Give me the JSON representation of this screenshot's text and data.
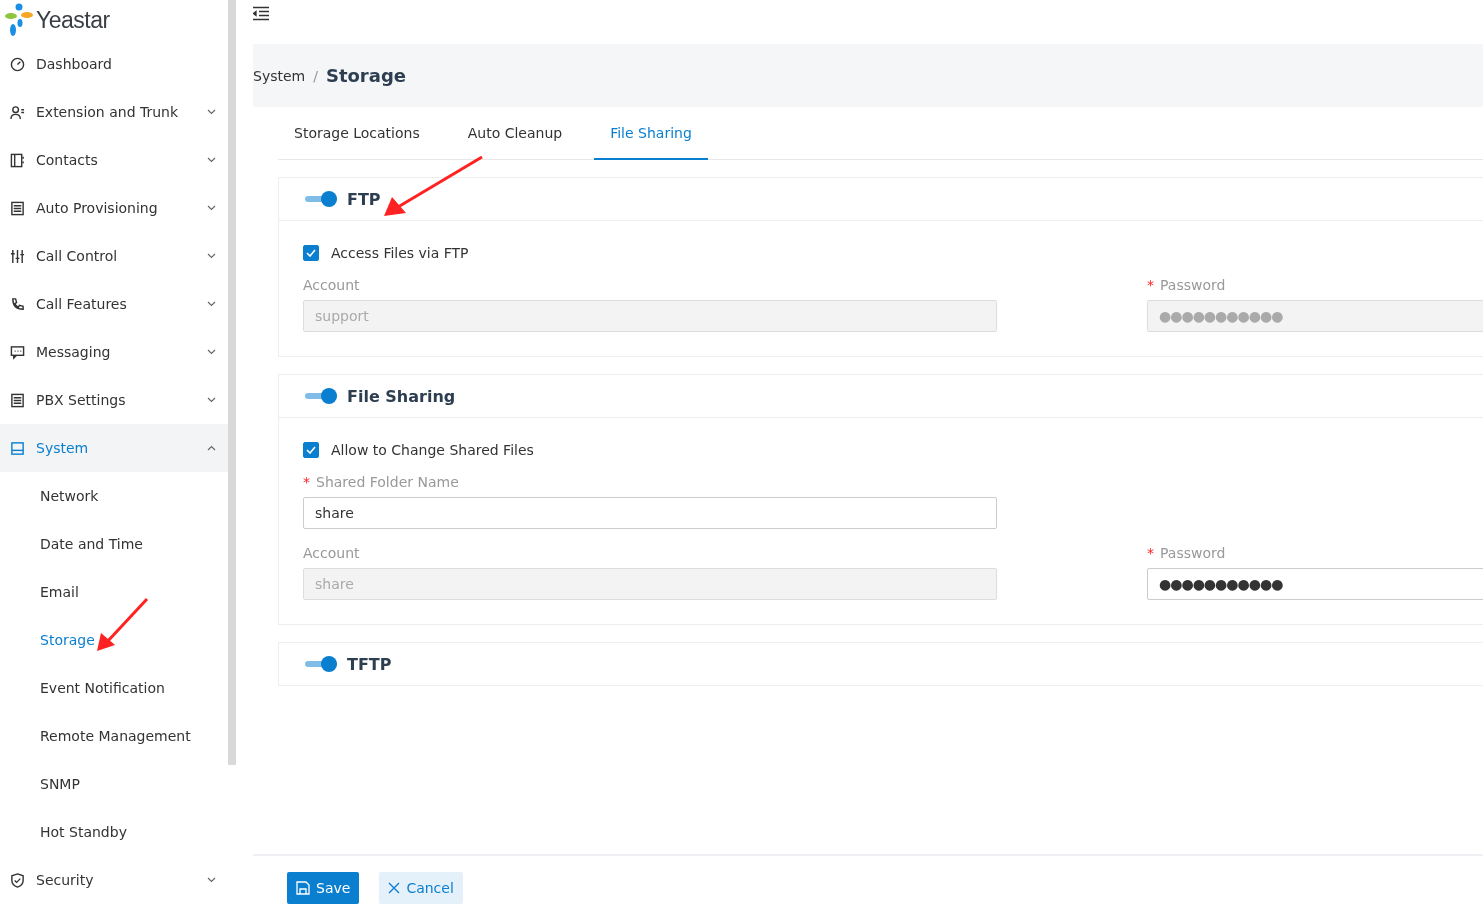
{
  "sidebar": {
    "logo": "Yeastar",
    "items": [
      {
        "label": "Dashboard",
        "selected": false
      },
      {
        "label": "Extension and Trunk",
        "selected": false,
        "expanded": false
      },
      {
        "label": "Contacts",
        "selected": false,
        "expanded": false
      },
      {
        "label": "Auto Provisioning",
        "selected": false,
        "expanded": false
      },
      {
        "label": "Call Control",
        "selected": false,
        "expanded": false
      },
      {
        "label": "Call Features",
        "selected": false,
        "expanded": false
      },
      {
        "label": "Messaging",
        "selected": false,
        "expanded": false
      },
      {
        "label": "PBX Settings",
        "selected": false,
        "expanded": false
      },
      {
        "label": "System",
        "selected": true,
        "expanded": true,
        "children": [
          {
            "label": "Network",
            "selected": false
          },
          {
            "label": "Date and Time",
            "selected": false
          },
          {
            "label": "Email",
            "selected": false
          },
          {
            "label": "Storage",
            "selected": true
          },
          {
            "label": "Event Notification",
            "selected": false
          },
          {
            "label": "Remote Management",
            "selected": false
          },
          {
            "label": "SNMP",
            "selected": false
          },
          {
            "label": "Hot Standby",
            "selected": false
          }
        ]
      },
      {
        "label": "Security",
        "selected": false,
        "expanded": false
      }
    ]
  },
  "breadcrumb": {
    "parent": "System",
    "separator": "/",
    "current": "Storage"
  },
  "tabs": [
    {
      "label": "Storage Locations",
      "selected": false
    },
    {
      "label": "Auto Cleanup",
      "selected": false
    },
    {
      "label": "File Sharing",
      "selected": true
    }
  ],
  "sections": [
    {
      "title": "FTP",
      "on": true,
      "checkbox": {
        "label": "Access Files via FTP",
        "checked": true
      },
      "fields": [
        {
          "label": "Account",
          "required": false,
          "value": "support",
          "disabled": true
        },
        {
          "label": "Password",
          "required": true,
          "value": "●●●●●●●●●●●",
          "disabled": true
        }
      ]
    },
    {
      "title": "File Sharing",
      "on": true,
      "checkbox": {
        "label": "Allow to Change Shared Files",
        "checked": true
      },
      "fields": [
        {
          "label": "Shared Folder Name",
          "required": true,
          "value": "share",
          "disabled": false
        },
        {
          "label": "Account",
          "required": false,
          "value": "share",
          "disabled": true
        },
        {
          "label": "Password",
          "required": true,
          "value": "●●●●●●●●●●●",
          "disabled": false
        }
      ]
    },
    {
      "title": "TFTP",
      "on": true
    }
  ],
  "required_mark": "*",
  "footer": {
    "save": "Save",
    "cancel": "Cancel"
  }
}
